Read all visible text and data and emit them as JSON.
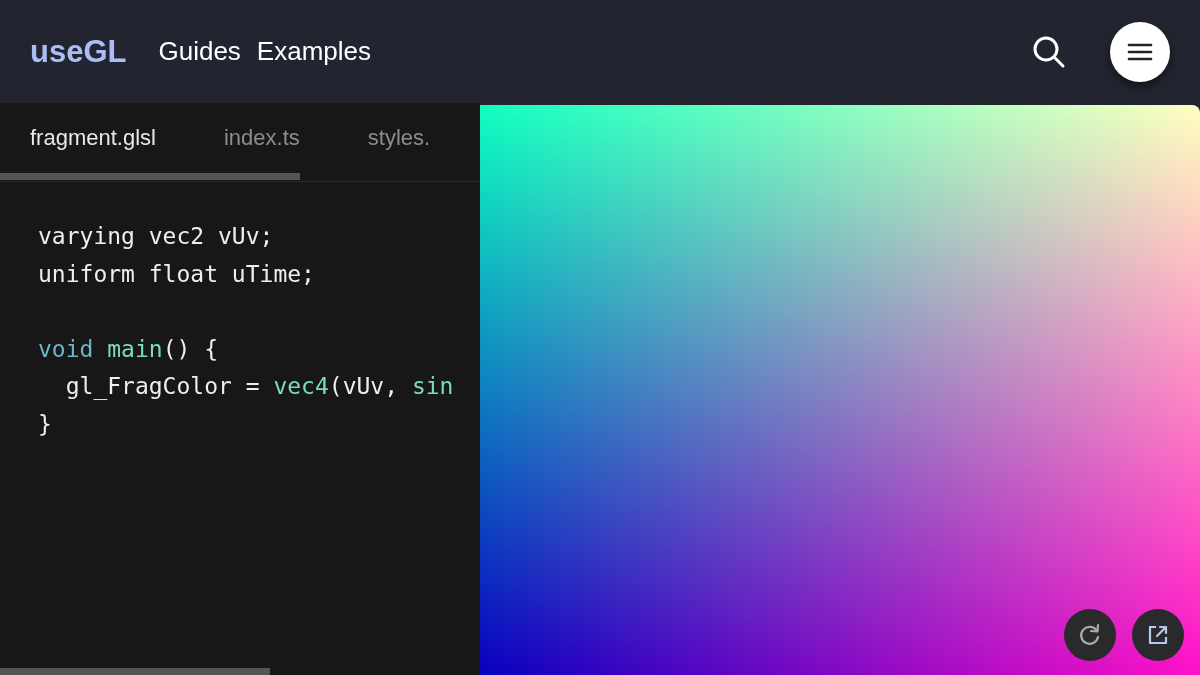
{
  "header": {
    "logo": "useGL",
    "nav": [
      "Guides",
      "Examples"
    ]
  },
  "tabs": [
    {
      "label": "fragment.glsl",
      "selected": true
    },
    {
      "label": "index.ts",
      "selected": false
    },
    {
      "label": "styles.",
      "selected": false
    }
  ],
  "code_lines": [
    {
      "kind": "code",
      "tokens": [
        {
          "text": "varying vec2 vUv;",
          "kind": "plain"
        }
      ]
    },
    {
      "kind": "code",
      "tokens": [
        {
          "text": "uniform float uTime;",
          "kind": "plain"
        }
      ]
    },
    {
      "kind": "blank"
    },
    {
      "kind": "code",
      "tokens": [
        {
          "text": "void",
          "kind": "keyword"
        },
        {
          "text": "main",
          "kind": "function"
        },
        {
          "text": "() {",
          "kind": "plain"
        }
      ]
    },
    {
      "kind": "code",
      "tokens": [
        {
          "text": "  gl_FragColor = ",
          "kind": "plain"
        },
        {
          "text": "vec4",
          "kind": "function"
        },
        {
          "text": "(vUv, ",
          "kind": "plain"
        },
        {
          "text": "sin",
          "kind": "function"
        }
      ]
    },
    {
      "kind": "code",
      "tokens": [
        {
          "text": "}",
          "kind": "plain"
        }
      ]
    }
  ]
}
